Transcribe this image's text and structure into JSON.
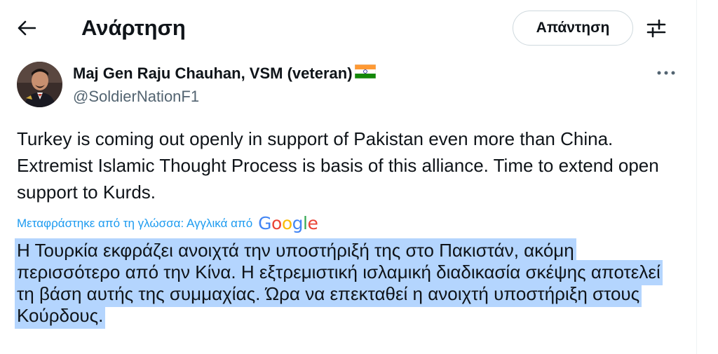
{
  "header": {
    "title": "Ανάρτηση",
    "back_icon": "arrow-left-icon",
    "reply_label": "Απάντηση",
    "settings_icon": "sliders-icon"
  },
  "post": {
    "author": {
      "name": "Maj Gen Raju Chauhan, VSM (veteran)",
      "flag_icon": "india-flag-icon",
      "handle": "@SoldierNationF1"
    },
    "more_icon": "more-horizontal-icon",
    "text": "Turkey is coming out openly in support of Pakistan even more than China. Extremist Islamic Thought Process is basis of this alliance. Time to extend open support to Kurds.",
    "translation_note": "Μεταφράστηκε από τη γλώσσα: Αγγλικά από",
    "translation_provider": "Google",
    "translated_text": "Η Τουρκία εκφράζει ανοιχτά την υποστήριξή της στο Πακιστάν, ακόμη περισσότερο από την Κίνα. Η εξτρεμιστική ισλαμική διαδικασία σκέψης αποτελεί τη βάση αυτής της συμμαχίας. Ώρα να επεκταθεί η ανοιχτή υποστήριξη στους Κούρδους."
  },
  "colors": {
    "accent": "#1d9bf0",
    "selection": "#b4d5fe",
    "secondary_text": "#536471",
    "border": "#cfd9de"
  }
}
